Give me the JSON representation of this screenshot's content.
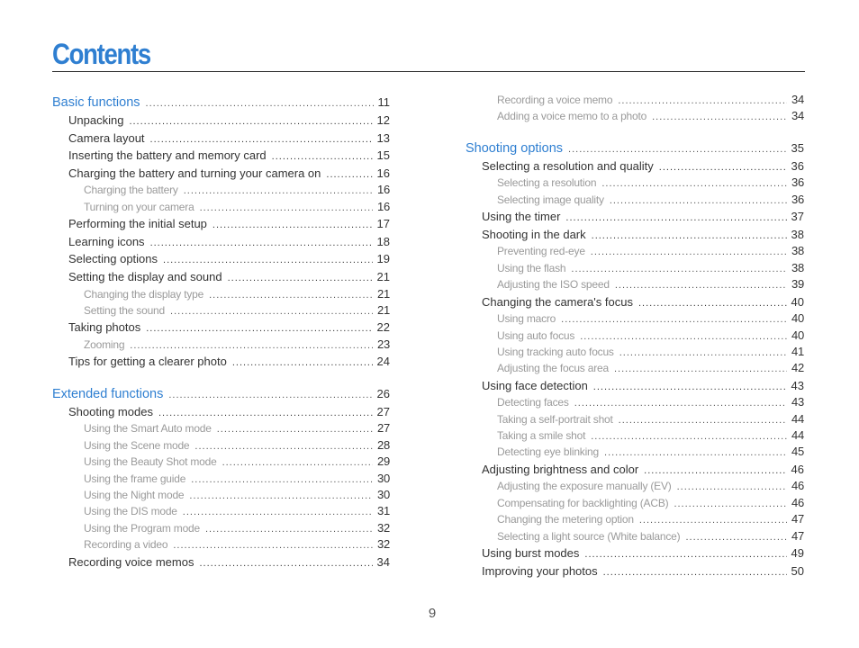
{
  "title": "Contents",
  "page_number": "9",
  "colors": {
    "heading": "#2f7fd1",
    "text": "#333333",
    "subtext": "#9a9a9a"
  },
  "left_column": [
    {
      "level": 0,
      "label": "Basic functions",
      "page": "11"
    },
    {
      "level": 1,
      "label": "Unpacking",
      "page": "12"
    },
    {
      "level": 1,
      "label": "Camera layout",
      "page": "13"
    },
    {
      "level": 1,
      "label": "Inserting the battery and memory card",
      "page": "15"
    },
    {
      "level": 1,
      "label": "Charging the battery and turning your camera on",
      "page": "16"
    },
    {
      "level": 2,
      "label": "Charging the battery",
      "page": "16"
    },
    {
      "level": 2,
      "label": "Turning on your camera",
      "page": "16"
    },
    {
      "level": 1,
      "label": "Performing the initial setup",
      "page": "17"
    },
    {
      "level": 1,
      "label": "Learning icons",
      "page": "18"
    },
    {
      "level": 1,
      "label": "Selecting options",
      "page": "19"
    },
    {
      "level": 1,
      "label": "Setting the display and sound",
      "page": "21"
    },
    {
      "level": 2,
      "label": "Changing the display type",
      "page": "21"
    },
    {
      "level": 2,
      "label": "Setting the sound",
      "page": "21"
    },
    {
      "level": 1,
      "label": "Taking photos",
      "page": "22"
    },
    {
      "level": 2,
      "label": "Zooming",
      "page": "23"
    },
    {
      "level": 1,
      "label": "Tips for getting a clearer photo",
      "page": "24"
    },
    {
      "gap": true
    },
    {
      "level": 0,
      "label": "Extended functions",
      "page": "26"
    },
    {
      "level": 1,
      "label": "Shooting modes",
      "page": "27"
    },
    {
      "level": 2,
      "label": "Using the Smart Auto mode",
      "page": "27"
    },
    {
      "level": 2,
      "label": "Using the Scene mode",
      "page": "28"
    },
    {
      "level": 2,
      "label": "Using the Beauty Shot mode",
      "page": "29"
    },
    {
      "level": 2,
      "label": "Using the frame guide",
      "page": "30"
    },
    {
      "level": 2,
      "label": "Using the Night mode",
      "page": "30"
    },
    {
      "level": 2,
      "label": "Using the DIS mode",
      "page": "31"
    },
    {
      "level": 2,
      "label": "Using the Program mode",
      "page": "32"
    },
    {
      "level": 2,
      "label": "Recording a video",
      "page": "32"
    },
    {
      "level": 1,
      "label": "Recording voice memos",
      "page": "34"
    }
  ],
  "right_column": [
    {
      "level": 2,
      "label": "Recording a voice memo",
      "page": "34"
    },
    {
      "level": 2,
      "label": "Adding a voice memo to a photo",
      "page": "34"
    },
    {
      "gap": true
    },
    {
      "level": 0,
      "label": "Shooting options",
      "page": "35"
    },
    {
      "level": 1,
      "label": "Selecting a resolution and quality",
      "page": "36"
    },
    {
      "level": 2,
      "label": "Selecting a resolution",
      "page": "36"
    },
    {
      "level": 2,
      "label": "Selecting image quality",
      "page": "36"
    },
    {
      "level": 1,
      "label": "Using the timer",
      "page": "37"
    },
    {
      "level": 1,
      "label": "Shooting in the dark",
      "page": "38"
    },
    {
      "level": 2,
      "label": "Preventing red-eye",
      "page": "38"
    },
    {
      "level": 2,
      "label": "Using the flash",
      "page": "38"
    },
    {
      "level": 2,
      "label": "Adjusting the ISO speed",
      "page": "39"
    },
    {
      "level": 1,
      "label": "Changing the camera's focus",
      "page": "40"
    },
    {
      "level": 2,
      "label": "Using macro",
      "page": "40"
    },
    {
      "level": 2,
      "label": "Using auto focus",
      "page": "40"
    },
    {
      "level": 2,
      "label": "Using tracking auto focus",
      "page": "41"
    },
    {
      "level": 2,
      "label": "Adjusting the focus area",
      "page": "42"
    },
    {
      "level": 1,
      "label": "Using face detection",
      "page": "43"
    },
    {
      "level": 2,
      "label": "Detecting faces",
      "page": "43"
    },
    {
      "level": 2,
      "label": "Taking a self-portrait shot",
      "page": "44"
    },
    {
      "level": 2,
      "label": "Taking a smile shot",
      "page": "44"
    },
    {
      "level": 2,
      "label": "Detecting eye blinking",
      "page": "45"
    },
    {
      "level": 1,
      "label": "Adjusting brightness and color",
      "page": "46"
    },
    {
      "level": 2,
      "label": "Adjusting the exposure manually (EV)",
      "page": "46"
    },
    {
      "level": 2,
      "label": "Compensating for backlighting (ACB)",
      "page": "46"
    },
    {
      "level": 2,
      "label": "Changing the metering option",
      "page": "47"
    },
    {
      "level": 2,
      "label": "Selecting a light source (White balance)",
      "page": "47"
    },
    {
      "level": 1,
      "label": "Using burst modes",
      "page": "49"
    },
    {
      "level": 1,
      "label": "Improving your photos",
      "page": "50"
    }
  ]
}
